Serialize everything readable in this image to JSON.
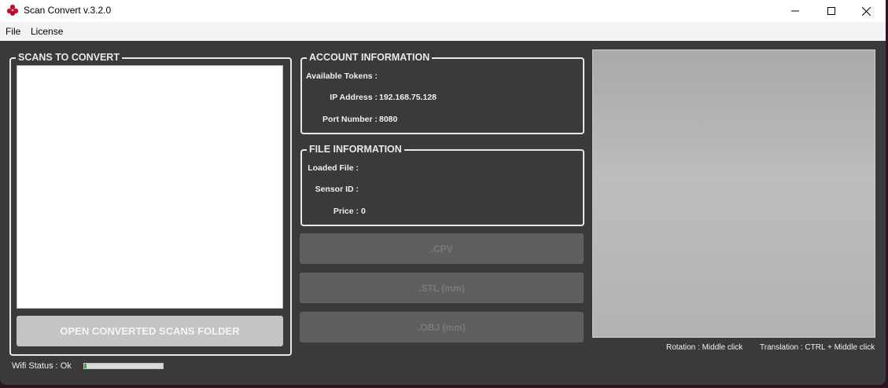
{
  "window": {
    "title": "Scan Convert v.3.2.0",
    "controls": {
      "minimize": "minimize-icon",
      "maximize": "maximize-icon",
      "close": "close-icon"
    }
  },
  "menu": {
    "file": "File",
    "license": "License"
  },
  "scans": {
    "group_title": "SCANS TO CONVERT",
    "items": [],
    "open_folder_button": "OPEN CONVERTED SCANS FOLDER"
  },
  "account": {
    "group_title": "ACCOUNT INFORMATION",
    "tokens_label": "Available Tokens :",
    "tokens_value": "",
    "ip_label": "IP Address :",
    "ip_value": "192.168.75.128",
    "port_label": "Port Number :",
    "port_value": "8080"
  },
  "file_info": {
    "group_title": "FILE INFORMATION",
    "loaded_label": "Loaded File :",
    "loaded_value": "",
    "sensor_label": "Sensor ID :",
    "sensor_value": "",
    "price_label": "Price :",
    "price_value": "0"
  },
  "buttons": {
    "cpv": ".CPV",
    "stl": ".STL (mm)",
    "obj": ".OBJ (mm)"
  },
  "viewer": {
    "rotation_hint": "Rotation : Middle click",
    "translation_hint": "Translation : CTRL + Middle click"
  },
  "status": {
    "wifi_label": "Wifi Status : Ok",
    "wifi_level": 0.03
  },
  "colors": {
    "window_bg": "#3a3a3a",
    "group_border": "#e8e8e8",
    "disabled_button": "#5f5f5f",
    "light_button": "#c4c4c4",
    "wifi_fill": "#1fb34a",
    "app_icon": "#c8102e"
  }
}
